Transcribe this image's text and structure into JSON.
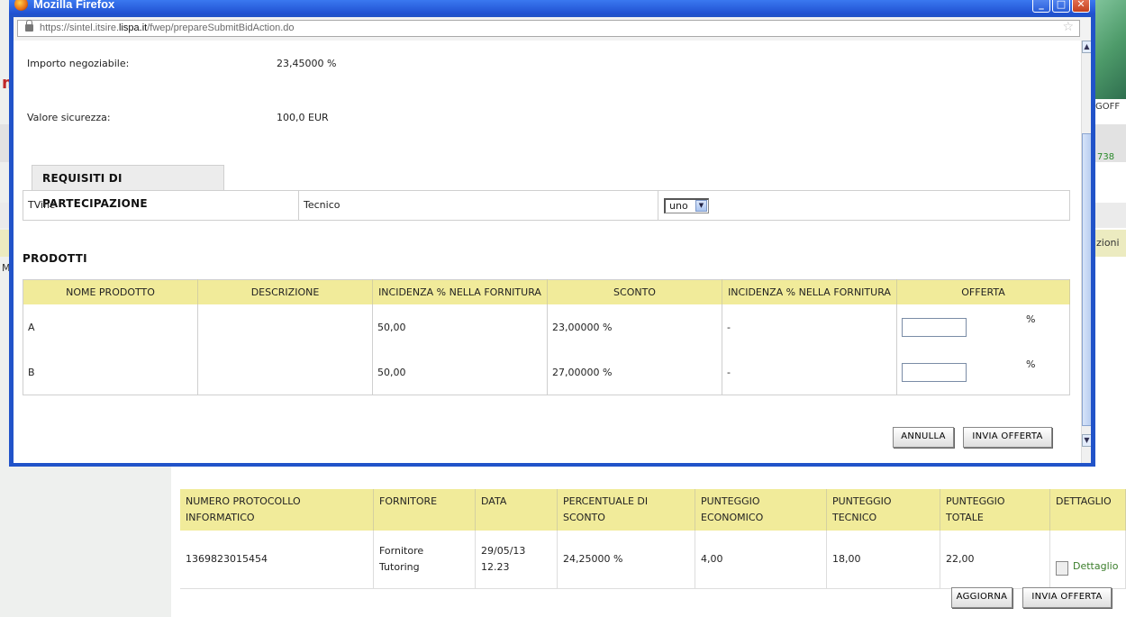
{
  "browser": {
    "title": "Mozilla Firefox",
    "url_prefix": "https://sintel.itsire.",
    "url_host": "lispa.it",
    "url_path": "/fwep/prepareSubmitBidAction.do",
    "window_controls": [
      "minimize-icon",
      "maximize-icon",
      "close-icon"
    ]
  },
  "dialog": {
    "fields": [
      {
        "label": "Importo negoziabile:",
        "value": "23,45000  %"
      },
      {
        "label": "Valore sicurezza:",
        "value": "100,0 EUR"
      }
    ],
    "requisiti": {
      "tab_label": "REQUISITI DI PARTECIPAZIONE",
      "col1": "TVinc",
      "col2": "Tecnico",
      "select_value": "uno"
    },
    "prodotti": {
      "title": "PRODOTTI",
      "headers": [
        "NOME PRODOTTO",
        "DESCRIZIONE",
        "INCIDENZA % NELLA FORNITURA",
        "SCONTO",
        "INCIDENZA % NELLA FORNITURA",
        "OFFERTA"
      ],
      "rows": [
        {
          "nome": "A",
          "descrizione": "",
          "incidenza": "50,00",
          "sconto": "23,00000 %",
          "incidenza2": "-",
          "offerta_value": "",
          "pct": "%"
        },
        {
          "nome": "B",
          "descrizione": "",
          "incidenza": "50,00",
          "sconto": "27,00000 %",
          "incidenza2": "-",
          "offerta_value": "",
          "pct": "%"
        }
      ]
    },
    "buttons": {
      "annulla": "ANNULLA",
      "invia": "INVIA OFFERTA"
    }
  },
  "background": {
    "logoff_text": "GOFF",
    "number_text": "738",
    "menu_text": "zioni",
    "m_text": "M",
    "table_headers": [
      [
        "NUMERO PROTOCOLLO",
        "INFORMATICO"
      ],
      [
        "FORNITORE",
        ""
      ],
      [
        "DATA",
        ""
      ],
      [
        "PERCENTUALE DI",
        "SCONTO"
      ],
      [
        "PUNTEGGIO",
        "ECONOMICO"
      ],
      [
        "PUNTEGGIO",
        "TECNICO"
      ],
      [
        "PUNTEGGIO",
        "TOTALE"
      ],
      [
        "DETTAGLIO",
        ""
      ]
    ],
    "row": {
      "protocollo": "1369823015454",
      "fornitore_1": "Fornitore",
      "fornitore_2": "Tutoring",
      "data_1": "29/05/13",
      "data_2": "12.23",
      "sconto": "24,25000 %",
      "economico": "4,00",
      "tecnico": "18,00",
      "totale": "22,00",
      "dettaglio": "Dettaglio"
    },
    "buttons": {
      "aggiorna": "AGGIORNA",
      "invia": "INVIA OFFERTA"
    }
  }
}
